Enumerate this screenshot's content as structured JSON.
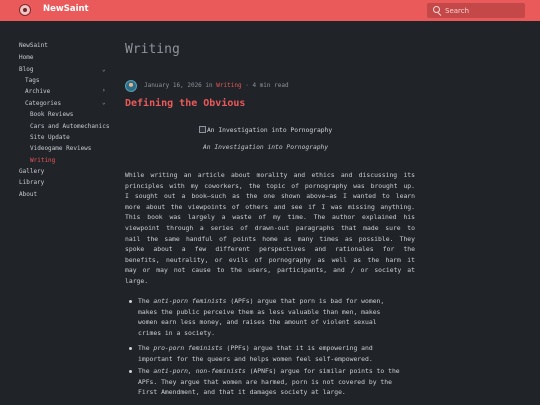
{
  "header": {
    "brand": "NewSaint",
    "search_placeholder": "Search"
  },
  "sidebar": {
    "items": [
      {
        "label": "NewSaint"
      },
      {
        "label": "Home"
      },
      {
        "label": "Blog"
      },
      {
        "label": "Tags"
      },
      {
        "label": "Archive"
      },
      {
        "label": "Categories"
      },
      {
        "label": "Book Reviews"
      },
      {
        "label": "Cars and Automechanics"
      },
      {
        "label": "Site Update"
      },
      {
        "label": "Videogame Reviews"
      },
      {
        "label": "Writing"
      },
      {
        "label": "Gallery"
      },
      {
        "label": "Library"
      },
      {
        "label": "About"
      }
    ]
  },
  "page": {
    "title": "Writing"
  },
  "post": {
    "date": "January 16, 2026",
    "in": "in",
    "category": "Writing",
    "sep": "·",
    "read_time": "4 min read",
    "title": "Defining the Obvious",
    "image_alt": "An Investigation into Pornography",
    "image_caption": "An Investigation into Pornography",
    "paragraph_lines": [
      "While writing an article about morality and ethics and discussing its",
      "principles with my coworkers, the topic of pornography was brought up.",
      "I sought out a book—such as the one shown above—as I wanted to learn",
      "more about the viewpoints of others and see if I was missing anything.",
      "This book was largely a waste of my time. The author explained his",
      "viewpoint through a series of drawn-out paragraphs that made sure to",
      "nail the same handful of points home as many times as possible. They",
      "spoke about a few different perspectives and rationales for the",
      "benefits, neutrality, or evils of pornography as well as the harm it",
      "may or may not cause to the users, participants, and / or society at",
      "large."
    ],
    "bullets": [
      {
        "lead": "The ",
        "em": "anti-porn feminists",
        "lines": [
          " (APFs) argue that porn is bad for women,",
          "makes the public perceive them as less valuable than men, makes",
          "women earn less money, and raises the amount of violent sexual",
          "crimes in a society."
        ]
      },
      {
        "lead": "The ",
        "em": "pro-porn feminists",
        "lines": [
          " (PPFs) argue that it is empowering and",
          "important for the queers and helps women feel self-empowered."
        ]
      },
      {
        "lead": "The ",
        "em": "anti-porn, non-feminists",
        "lines": [
          " (APNFs) argue for similar points to the",
          "APFs. They argue that women are harmed, porn is not covered by the",
          "First Amendment, and that it damages society at large."
        ]
      }
    ]
  }
}
